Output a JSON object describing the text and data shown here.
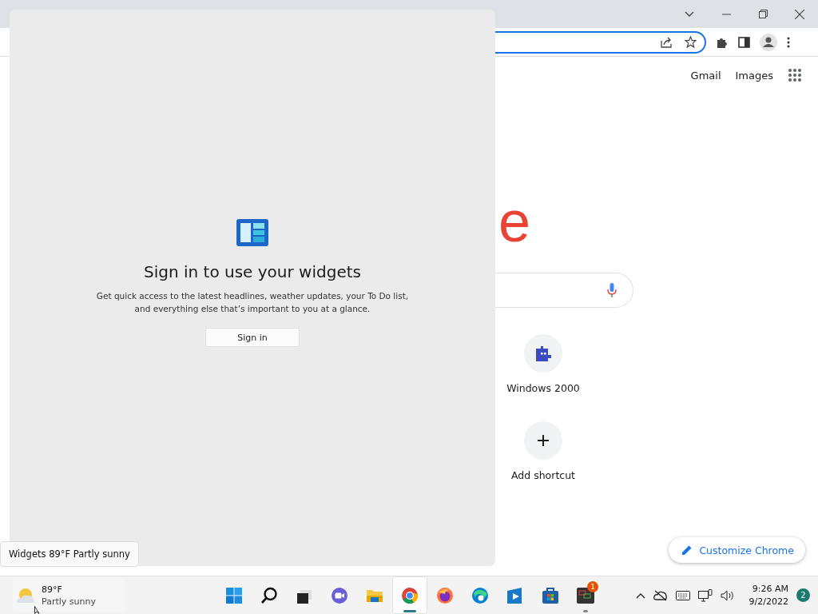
{
  "browser": {
    "header_links": [
      "Gmail",
      "Images"
    ],
    "logo_fragment": "e",
    "shortcuts": [
      {
        "kind": "site",
        "label": "Windows 2000"
      },
      {
        "kind": "add",
        "label": "Add shortcut"
      }
    ],
    "customize_button": "Customize Chrome"
  },
  "widgets_panel": {
    "title": "Sign in to use your widgets",
    "description": "Get quick access to the latest headlines, weather updates, your To Do list, and everything else that’s important to you at a glance.",
    "button": "Sign in"
  },
  "tooltip": "Widgets 89°F Partly sunny",
  "taskbar": {
    "weather": {
      "temperature": "89°F",
      "condition": "Partly sunny"
    },
    "apps": [
      {
        "kind": "start",
        "active": false,
        "running": false
      },
      {
        "kind": "search",
        "active": false,
        "running": false
      },
      {
        "kind": "task-view",
        "active": false,
        "running": false
      },
      {
        "kind": "chat",
        "active": false,
        "running": false
      },
      {
        "kind": "explorer",
        "active": false,
        "running": false
      },
      {
        "kind": "chrome",
        "active": true,
        "running": true
      },
      {
        "kind": "firefox",
        "active": false,
        "running": false
      },
      {
        "kind": "edge",
        "active": false,
        "running": false
      },
      {
        "kind": "media",
        "active": false,
        "running": false
      },
      {
        "kind": "store",
        "active": false,
        "running": false
      },
      {
        "kind": "terminal",
        "active": false,
        "running": true,
        "badge": "1"
      }
    ],
    "clock": {
      "time": "9:26 AM",
      "date": "9/2/2022"
    },
    "notification_count": "2"
  }
}
